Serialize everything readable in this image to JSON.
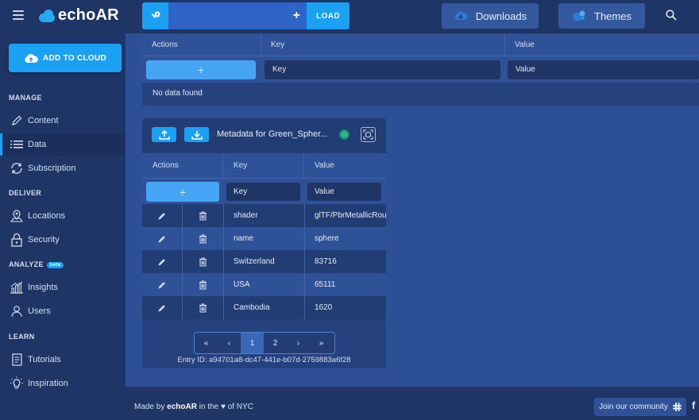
{
  "header": {
    "logo_text": "echoAR",
    "load_label": "LOAD",
    "add_symbol": "+",
    "downloads_label": "Downloads",
    "themes_label": "Themes"
  },
  "sidebar": {
    "add_cloud_label": "ADD TO CLOUD",
    "sections": {
      "manage": "MANAGE",
      "deliver": "DELIVER",
      "analyze": "ANALYZE",
      "analyze_badge": "beta",
      "learn": "LEARN"
    },
    "items": {
      "content": "Content",
      "data": "Data",
      "subscription": "Subscription",
      "locations": "Locations",
      "security": "Security",
      "insights": "Insights",
      "users": "Users",
      "tutorials": "Tutorials",
      "inspiration": "Inspiration"
    }
  },
  "top_table": {
    "columns": [
      "Actions",
      "Key",
      "Value"
    ],
    "add_symbol": "+",
    "key_value": "Key",
    "value_value": "Value",
    "empty_text": "No data found"
  },
  "metadata_card": {
    "title": "Metadata for Green_Spher...",
    "columns": [
      "Actions",
      "Key",
      "Value"
    ],
    "add_symbol": "+",
    "key_value": "Key",
    "value_value": "Value",
    "rows": [
      {
        "key": "shader",
        "value": "glTF/PbrMetallicRou"
      },
      {
        "key": "name",
        "value": "sphere"
      },
      {
        "key": "Switzerland",
        "value": "83716"
      },
      {
        "key": "USA",
        "value": "65111"
      },
      {
        "key": "Cambodia",
        "value": "1620"
      }
    ],
    "pagination": [
      "«",
      "‹",
      "1",
      "2",
      "›",
      "»"
    ],
    "current_page": "1",
    "entry_id": "Entry ID: a94701a8-dc47-441e-b07d-2759883a6f28"
  },
  "footer": {
    "made_by_prefix": "Made by",
    "brand": "echoAR",
    "in_the": "in the",
    "heart": "♥",
    "of_nyc": "of NYC",
    "community_label": "Join our community",
    "facebook": "f"
  },
  "colors": {
    "accent": "#1aa1f3",
    "sidebar_bg": "#1f3566",
    "page_bg": "#2d4f96",
    "row_alt": "#2e5198",
    "status_green": "#2bb58a"
  }
}
